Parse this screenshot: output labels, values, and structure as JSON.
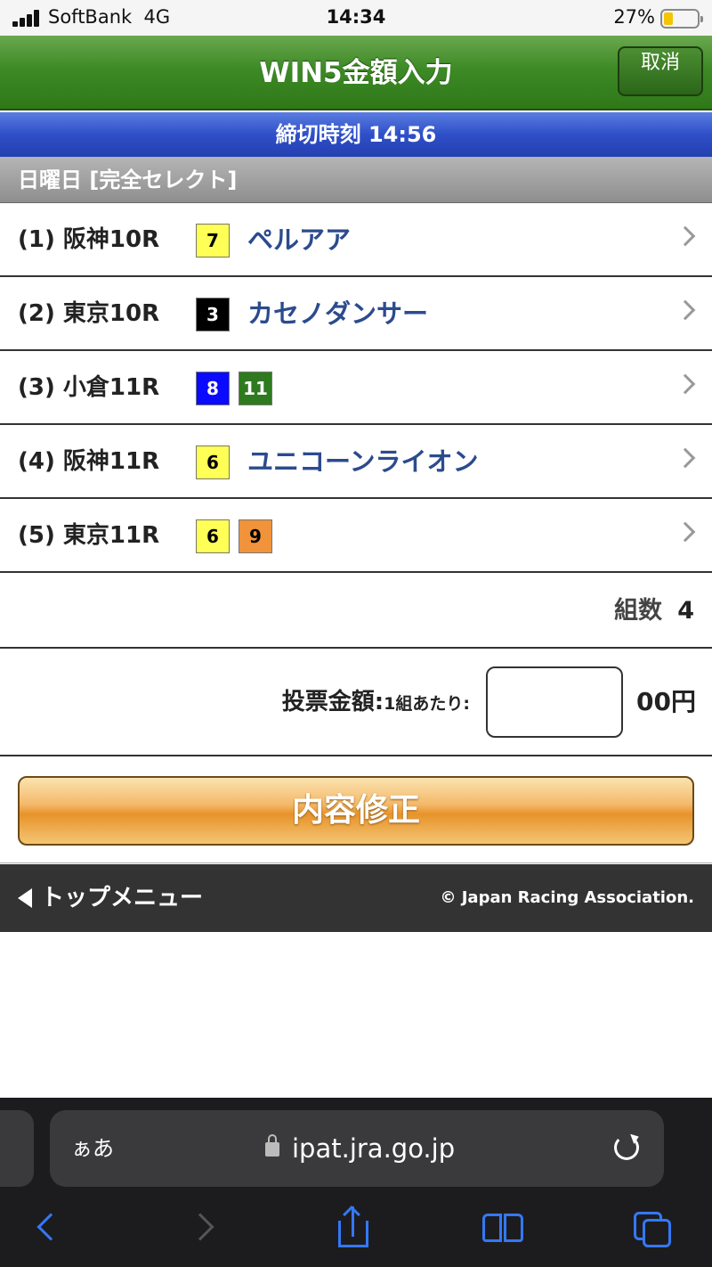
{
  "status_bar": {
    "carrier": "SoftBank",
    "network": "4G",
    "time": "14:34",
    "battery": "27%"
  },
  "header": {
    "title": "WIN5金額入力",
    "cancel_label": "取消"
  },
  "deadline": {
    "label": "締切時刻",
    "time": "14:56"
  },
  "section_title": "日曜日 [完全セレクト]",
  "races": [
    {
      "label": "(1) 阪神10R",
      "boxes": [
        {
          "num": "7",
          "bg": "#ffff55",
          "fg": "#000000"
        }
      ],
      "horse": "ペルアア"
    },
    {
      "label": "(2) 東京10R",
      "boxes": [
        {
          "num": "3",
          "bg": "#000000",
          "fg": "#ffffff"
        }
      ],
      "horse": "カセノダンサー"
    },
    {
      "label": "(3) 小倉11R",
      "boxes": [
        {
          "num": "8",
          "bg": "#0a0aff",
          "fg": "#ffffff"
        },
        {
          "num": "11",
          "bg": "#2e7a1e",
          "fg": "#ffffff"
        }
      ],
      "horse": ""
    },
    {
      "label": "(4) 阪神11R",
      "boxes": [
        {
          "num": "6",
          "bg": "#ffff55",
          "fg": "#000000"
        }
      ],
      "horse": "ユニコーンライオン"
    },
    {
      "label": "(5) 東京11R",
      "boxes": [
        {
          "num": "6",
          "bg": "#ffff55",
          "fg": "#000000"
        },
        {
          "num": "9",
          "bg": "#f0933a",
          "fg": "#000000"
        }
      ],
      "horse": ""
    }
  ],
  "count": {
    "label": "組数",
    "value": "4"
  },
  "amount": {
    "label": "投票金額:",
    "sublabel": "1組あたり:",
    "value": "",
    "unit": "00円"
  },
  "submit_label": "内容修正",
  "footer": {
    "top_menu": "トップメニュー",
    "copyright": "© Japan Racing Association."
  },
  "safari": {
    "aa": "ぁあ",
    "url": "ipat.jra.go.jp"
  },
  "colors": {
    "header_green": "#3d8a26",
    "deadline_blue": "#2f4fc9",
    "horse_blue": "#2c4b8e",
    "button_orange": "#e8932a",
    "ios_blue": "#3478f6"
  }
}
